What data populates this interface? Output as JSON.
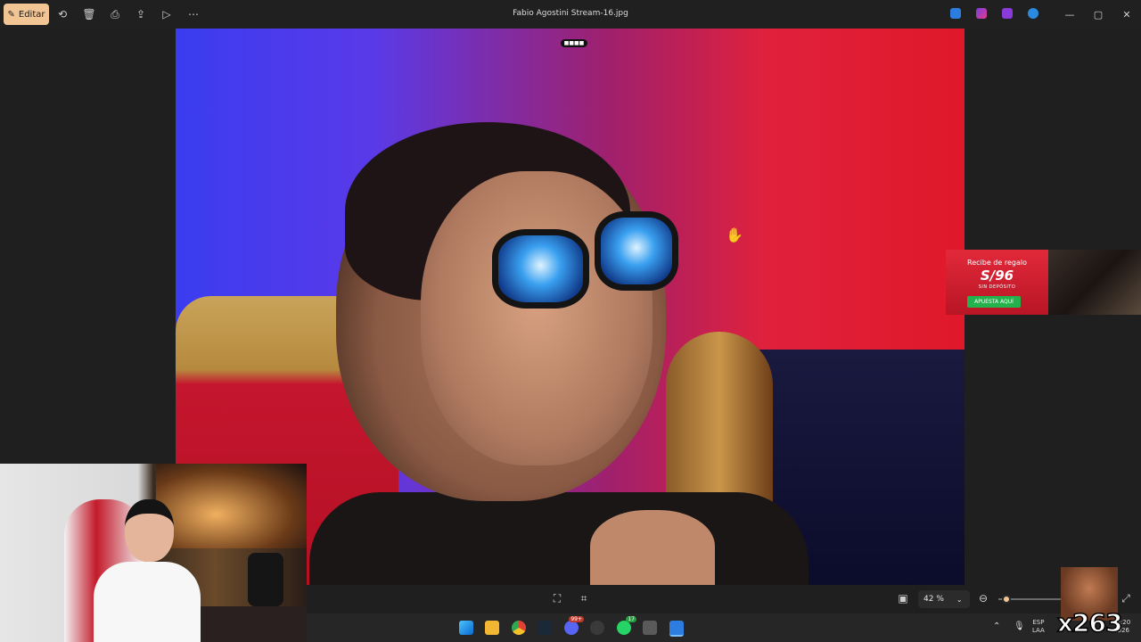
{
  "titlebar": {
    "edit_label": "Editar",
    "file_name": "Fabio Agostini Stream-16.jpg",
    "window_controls": [
      "—",
      "▢",
      "✕"
    ]
  },
  "photo": {
    "top_badge": "■■■■"
  },
  "ad": {
    "line1": "Recibe de regalo",
    "amount": "S/96",
    "line3": "SIN DEPÓSITO",
    "cta": "APUESTA AQUÍ"
  },
  "bottombar": {
    "zoom_value": "42 %",
    "zoom_level_fraction": 0.05
  },
  "taskbar": {
    "discord_badge": "99+",
    "whatsapp_badge": "17",
    "lang_line1": "ESP",
    "lang_line2": "LAA",
    "time": "13:20",
    "date": "2026"
  },
  "overlay": {
    "counter": "x263"
  },
  "colors": {
    "accent": "#f2c595",
    "titlebar_bg": "#202020",
    "canvas_bg": "#1f1f1f",
    "taskbar_bg": "#262626"
  }
}
